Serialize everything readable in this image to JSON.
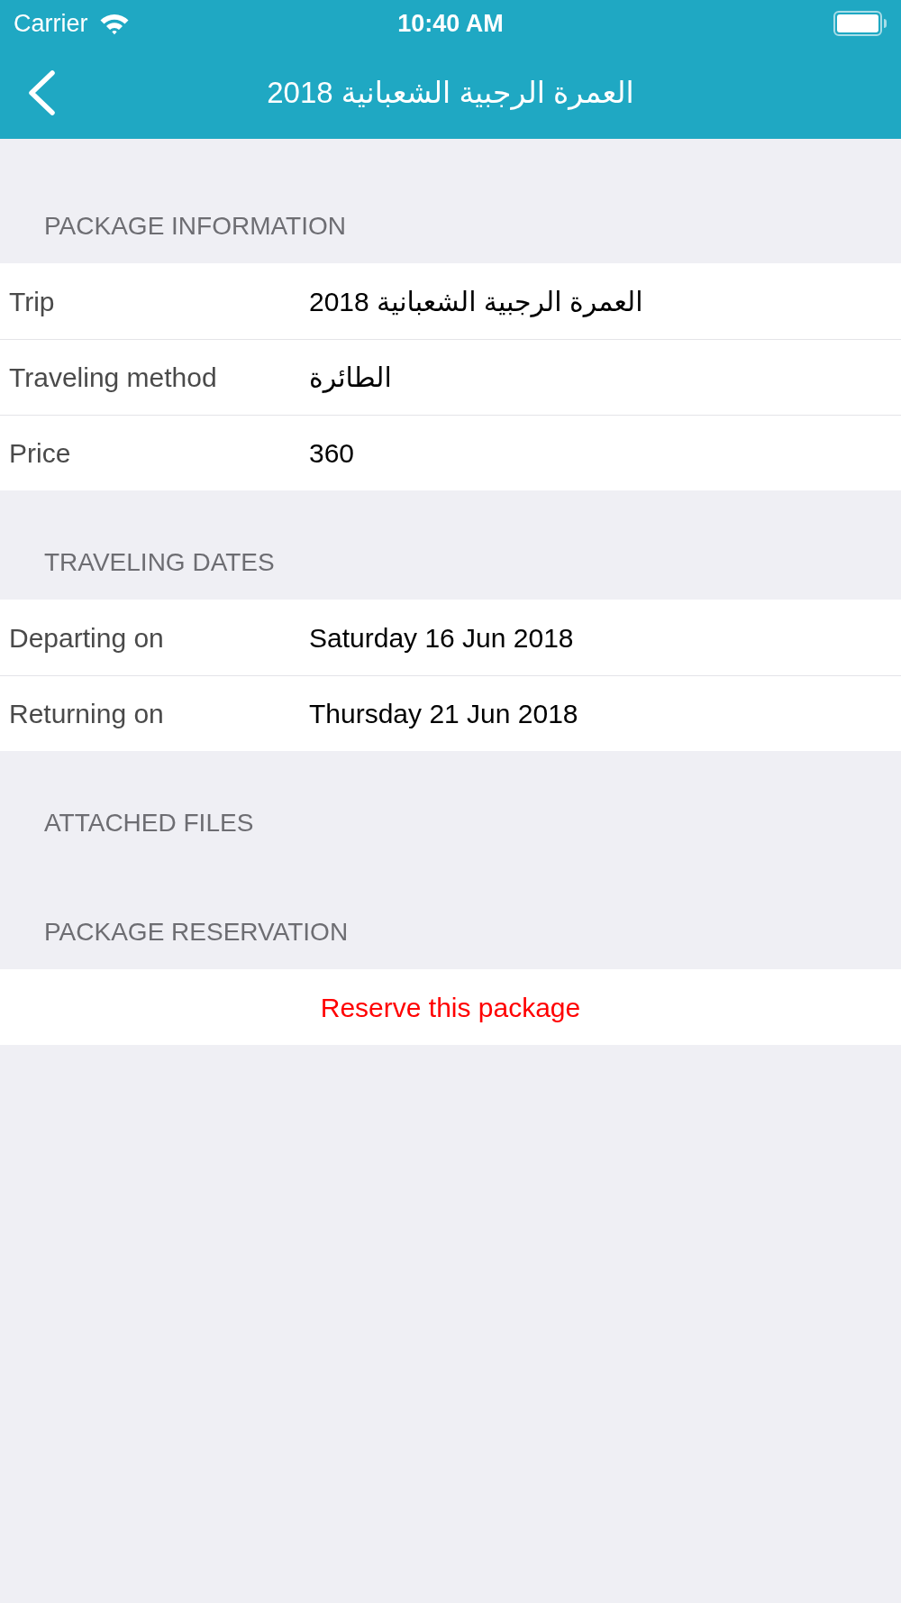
{
  "status_bar": {
    "carrier": "Carrier",
    "time": "10:40 AM"
  },
  "nav_bar": {
    "title": "العمرة الرجبية الشعبانية 2018"
  },
  "sections": [
    {
      "header": "PACKAGE INFORMATION",
      "items": [
        {
          "kind": "field",
          "label": "Trip",
          "value": "العمرة الرجبية الشعبانية 2018"
        },
        {
          "kind": "field",
          "label": "Traveling method",
          "value": "الطائرة"
        },
        {
          "kind": "field",
          "label": "Price",
          "value": "360"
        }
      ]
    },
    {
      "header": "TRAVELING DATES",
      "items": [
        {
          "kind": "field",
          "label": "Departing on",
          "value": "Saturday 16 Jun 2018"
        },
        {
          "kind": "field",
          "label": "Returning on",
          "value": "Thursday 21 Jun 2018"
        }
      ]
    },
    {
      "header": "ATTACHED FILES"
    },
    {
      "header": "PACKAGE RESERVATION",
      "items": [
        {
          "kind": "action",
          "label": "Reserve this package"
        }
      ]
    }
  ]
}
